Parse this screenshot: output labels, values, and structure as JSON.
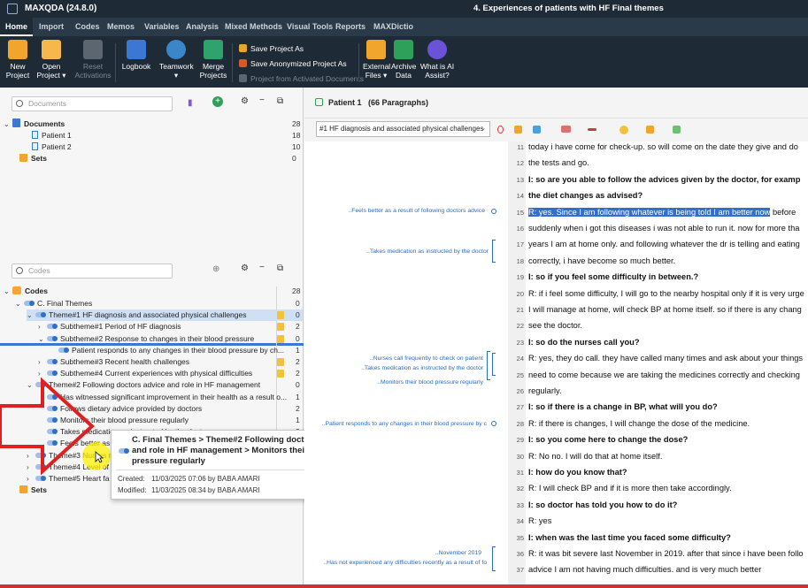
{
  "app": {
    "title": "MAXQDA (24.8.0)",
    "document_title": "4. Experiences of patients with HF Final themes"
  },
  "tabs": [
    "Home",
    "Import",
    "Codes",
    "Memos",
    "Variables",
    "Analysis",
    "Mixed Methods",
    "Visual Tools",
    "Reports",
    "MAXDictio"
  ],
  "ribbon": {
    "new_project": "New\nProject",
    "open_project": "Open\nProject",
    "reset_activations": "Reset\nActivations",
    "logbook": "Logbook",
    "teamwork": "Teamwork",
    "merge_projects": "Merge\nProjects",
    "save_project_as": "Save Project As",
    "save_anonymized": "Save Anonymized Project As",
    "project_from_activated": "Project from Activated Documents",
    "external_files": "External\nFiles",
    "archive_data": "Archive\nData",
    "ai_assist": "What is AI\nAssist?",
    "ai_badge": "New"
  },
  "documents_pane": {
    "search_placeholder": "Documents",
    "root": {
      "label": "Documents",
      "count": "28"
    },
    "items": [
      {
        "label": "Patient 1",
        "count": "18"
      },
      {
        "label": "Patient 2",
        "count": "10"
      }
    ],
    "sets": {
      "label": "Sets",
      "count": "0"
    }
  },
  "codes_pane": {
    "search_placeholder": "Codes",
    "root": {
      "label": "Codes",
      "count": "28"
    },
    "rows": [
      {
        "label": "C. Final Themes",
        "count": "0"
      },
      {
        "label": "Theme#1 HF diagnosis and associated physical challenges",
        "count": "0"
      },
      {
        "label": "Subtheme#1 Period of HF diagnosis",
        "count": "2"
      },
      {
        "label": "Subtheme#2 Response to changes in their blood pressure",
        "count": "0"
      },
      {
        "label": "Patient responds to any changes in their blood pressure by ch...",
        "count": "1"
      },
      {
        "label": "Subtheme#3 Recent health challenges",
        "count": "2"
      },
      {
        "label": "Subtheme#4 Current experiences with physical difficulties",
        "count": "2"
      },
      {
        "label": "Theme#2 Following doctors advice and role in HF management",
        "count": "0"
      },
      {
        "label": "Has witnessed significant improvement in their health as a result o...",
        "count": "1"
      },
      {
        "label": "Follows dietary advice provided by doctors",
        "count": "2"
      },
      {
        "label": "Monitors their blood pressure regularly",
        "count": "1"
      },
      {
        "label": "Takes medication as instructed by the doctor",
        "count": "2"
      },
      {
        "label": "Feels better as a result of following doctors advice",
        "count": "1"
      },
      {
        "label": "Theme#3 Nurses role",
        "count": "1"
      },
      {
        "label": "Theme#4 Level of",
        "count": "0"
      },
      {
        "label": "Theme#5 Heart fa",
        "count": "0"
      }
    ],
    "sets": {
      "label": "Sets",
      "count": "0"
    }
  },
  "tooltip": {
    "title": "C. Final Themes > Theme#2 Following doctors advice and role in HF management > Monitors their blood pressure regularly",
    "created_label": "Created:",
    "created_value": "11/03/2025 07:06 by BABA AMARI",
    "modified_label": "Modified:",
    "modified_value": "11/03/2025 08:34 by BABA AMARI"
  },
  "document_browser": {
    "document": "Patient 1",
    "paragraphs": "(66 Paragraphs)",
    "code_dropdown": "#1 HF diagnosis and associated physical challenges",
    "more": "...",
    "margin_codes": [
      "..Feels better as a result of following doctors advice",
      "..Takes medication as instructed by the doctor",
      "..Nurses call frequently to check on patient",
      "..Takes medication as instructed by the doctor",
      "..Monitors their blood pressure regularly",
      "..Patient responds to any changes in their blood pressure by c",
      "..November 2019",
      "..Has not experienced any difficulties recently as a result of fo"
    ],
    "lines": [
      {
        "n": "11",
        "text": "today i have come for check-up. so will come on the date they give and do",
        "bold": false
      },
      {
        "n": "12",
        "text": "the tests and go.",
        "bold": false
      },
      {
        "n": "13",
        "text": "I: so are you able to follow the advices given by the doctor, for examp",
        "bold": true
      },
      {
        "n": "14",
        "text": "the diet changes as advised?",
        "bold": true
      },
      {
        "n": "15",
        "text": "R: yes. Since I am following whatever is being told I am better now",
        "bold": false,
        "tail": " before"
      },
      {
        "n": "16",
        "text": "suddenly when i got this diseases i was not able to run it. now for more tha",
        "bold": false
      },
      {
        "n": "17",
        "text": "years I am at home only. and following whatever the dr is telling and eating",
        "bold": false
      },
      {
        "n": "18",
        "text": "correctly, i have become so much better.",
        "bold": false
      },
      {
        "n": "19",
        "text": "I: so if you feel some difficulty in between.?",
        "bold": true
      },
      {
        "n": "20",
        "text": "R: if i feel some difficulty, I will go to the nearby hospital only if it is very urge",
        "bold": false
      },
      {
        "n": "21",
        "text": "I will manage at home, will check BP at home itself. so if there is any chang",
        "bold": false
      },
      {
        "n": "22",
        "text": "see the doctor.",
        "bold": false
      },
      {
        "n": "23",
        "text": "I: so do the nurses call you?",
        "bold": true
      },
      {
        "n": "24",
        "text": "R: yes, they do call. they have called many times and ask about your things",
        "bold": false
      },
      {
        "n": "25",
        "text": "need to come because we are taking the medicines correctly and checking",
        "bold": false
      },
      {
        "n": "26",
        "text": "regularly.",
        "bold": false
      },
      {
        "n": "27",
        "text": "I: so if there is a change in BP, what will you do?",
        "bold": true
      },
      {
        "n": "28",
        "text": "R: if there is changes, I will change the dose of the medicine.",
        "bold": false
      },
      {
        "n": "29",
        "text": "I: so you come here to change the dose?",
        "bold": true
      },
      {
        "n": "30",
        "text": "R: No no. I will do that at home itself.",
        "bold": false
      },
      {
        "n": "31",
        "text": "I: how do you know that?",
        "bold": true
      },
      {
        "n": "32",
        "text": "R: I will check BP and if it is more then take accordingly.",
        "bold": false
      },
      {
        "n": "33",
        "text": "I: so doctor has told you how to do it?",
        "bold": true
      },
      {
        "n": "34",
        "text": "R: yes",
        "bold": false
      },
      {
        "n": "35",
        "text": "I: when was the last time you faced some difficulty?",
        "bold": true
      },
      {
        "n": "36",
        "text": "R: it was bit severe last November in 2019. after that since i have been follo",
        "bold": false
      },
      {
        "n": "37",
        "text": "advice I am not having much difficulties. and is very much better",
        "bold": false
      }
    ]
  },
  "colors": {
    "accent": "#2f6fd0",
    "ribbon_bg": "#1e2a36",
    "code_blue": "#2b6cc4",
    "arrow_red": "#e02020",
    "cursor_yellow": "#fff000"
  }
}
